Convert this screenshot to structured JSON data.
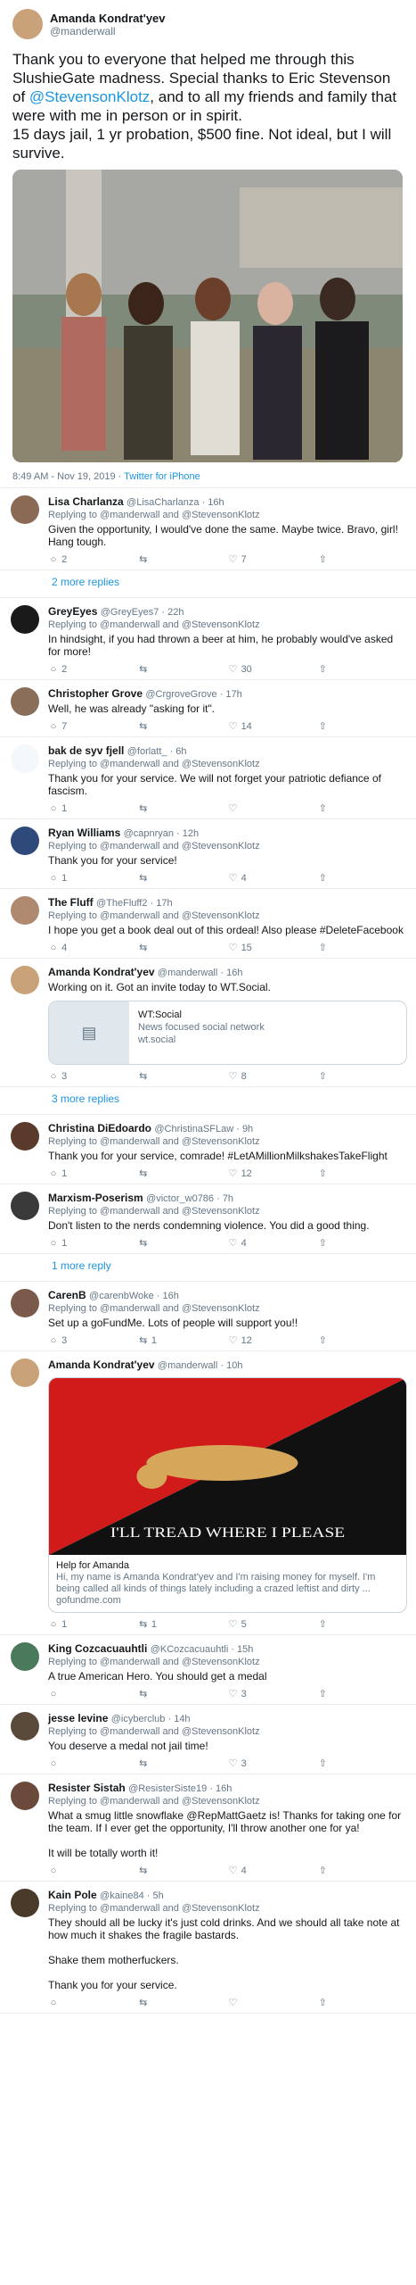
{
  "tweet": {
    "author": "Amanda Kondrat'yev",
    "handle": "@manderwall",
    "text_prefix": "Thank you to everyone that helped me through this SlushieGate madness. Special thanks to Eric Stevenson of ",
    "text_link": "@StevensonKlotz",
    "text_suffix": ", and to all my friends and family that were with me in person or in spirit.\n15 days jail, 1 yr probation, $500 fine. Not ideal, but I will survive.",
    "timestamp": "8:49 AM - Nov 19, 2019 · ",
    "client": "Twitter for iPhone"
  },
  "replies": [
    {
      "name": "Lisa Charlanza",
      "handle": "@LisaCharlanza · 16h",
      "replying": "Replying to @manderwall and @StevensonKlotz",
      "text": "Given the opportunity, I would've done the same. Maybe twice. Bravo, girl! Hang tough.",
      "reply_count": "2",
      "retweet_count": "",
      "like_count": "7"
    },
    {
      "name": "GreyEyes",
      "handle": "@GreyEyes7 · 22h",
      "replying": "Replying to @manderwall and @StevensonKlotz",
      "text": "In hindsight, if you had thrown a beer at him, he probably would've asked for more!",
      "reply_count": "2",
      "retweet_count": "",
      "like_count": "30"
    },
    {
      "name": "Christopher Grove",
      "handle": "@CrgroveGrove · 17h",
      "replying": "",
      "text": "Well, he was already \"asking for it\".",
      "reply_count": "7",
      "retweet_count": "",
      "like_count": "14"
    },
    {
      "name": "bak de syv fjell",
      "handle": "@forlatt_ · 6h",
      "replying": "Replying to @manderwall and @StevensonKlotz",
      "text": "Thank you for your service. We will not forget your patriotic defiance of fascism.",
      "reply_count": "1",
      "retweet_count": "",
      "like_count": ""
    },
    {
      "name": "Ryan Williams",
      "handle": "@capnryan · 12h",
      "replying": "Replying to @manderwall and @StevensonKlotz",
      "text": "Thank you for your service!",
      "reply_count": "1",
      "retweet_count": "",
      "like_count": "4"
    },
    {
      "name": "The Fluff",
      "handle": "@TheFluff2 · 17h",
      "replying": "Replying to @manderwall and @StevensonKlotz",
      "text": "I hope you get a book deal out of this ordeal! Also please #DeleteFacebook",
      "reply_count": "4",
      "retweet_count": "",
      "like_count": "15"
    },
    {
      "name": "Amanda Kondrat'yev",
      "handle": "@manderwall · 16h",
      "replying": "",
      "text": "Working on it. Got an invite today to WT.Social.",
      "reply_count": "3",
      "retweet_count": "",
      "like_count": "8"
    },
    {
      "name": "Christina DiEdoardo",
      "handle": "@ChristinaSFLaw · 9h",
      "replying": "Replying to @manderwall and @StevensonKlotz",
      "text": "Thank you for your service, comrade! #LetAMillionMilkshakesTakeFlight",
      "reply_count": "1",
      "retweet_count": "",
      "like_count": "12"
    },
    {
      "name": "Marxism-Poserism",
      "handle": "@victor_w0786 · 7h",
      "replying": "Replying to @manderwall and @StevensonKlotz",
      "text": "Don't listen to the nerds condemning violence. You did a good thing.",
      "reply_count": "1",
      "retweet_count": "",
      "like_count": "4"
    },
    {
      "name": "CarenB",
      "handle": "@carenbWoke · 16h",
      "replying": "Replying to @manderwall and @StevensonKlotz",
      "text": "Set up a goFundMe.  Lots of people will support you!!",
      "reply_count": "3",
      "retweet_count": "1",
      "like_count": "12"
    },
    {
      "name": "Amanda Kondrat'yev",
      "handle": "@manderwall · 10h",
      "replying": "",
      "text": "",
      "reply_count": "1",
      "retweet_count": "1",
      "like_count": "5"
    },
    {
      "name": "King Cozcacuauhtli",
      "handle": "@KCozcacuauhtli · 15h",
      "replying": "Replying to @manderwall and @StevensonKlotz",
      "text": "A true American Hero. You should get a medal",
      "reply_count": "",
      "retweet_count": "",
      "like_count": "3"
    },
    {
      "name": "jesse levine",
      "handle": "@icyberclub · 14h",
      "replying": "Replying to @manderwall and @StevensonKlotz",
      "text": "You deserve a medal not jail time!",
      "reply_count": "",
      "retweet_count": "",
      "like_count": "3"
    },
    {
      "name": "Resister Sistah",
      "handle": "@ResisterSiste19 · 16h",
      "replying": "Replying to @manderwall and @StevensonKlotz",
      "text": "What a smug little snowflake @RepMattGaetz is! Thanks for taking one for the team. If I ever get the opportunity, I'll throw another one for ya!\n\nIt will be totally worth it!",
      "reply_count": "",
      "retweet_count": "",
      "like_count": "4"
    },
    {
      "name": "Kain Pole",
      "handle": "@kaine84 · 5h",
      "replying": "Replying to @manderwall and @StevensonKlotz",
      "text": "They should all be lucky it's just cold drinks. And we should all take note at how much it shakes the fragile bastards.\n\nShake them motherfuckers.\n\nThank you for your service.",
      "reply_count": "",
      "retweet_count": "",
      "like_count": ""
    }
  ],
  "more_replies": {
    "first": "2 more replies",
    "second": "3 more replies",
    "third": "1 more reply"
  },
  "wt_card": {
    "title": "WT:Social",
    "desc": "News focused social network",
    "url": "wt.social"
  },
  "gofund_card": {
    "banner": "I'LL TREAD WHERE I PLEASE",
    "title": "Help for Amanda",
    "desc": "Hi, my name is Amanda Kondrat'yev and I'm raising money for myself. I'm being called all kinds of things lately including a crazed leftist and dirty ...",
    "url": "gofundme.com"
  },
  "icons": {
    "reply": "reply-icon",
    "retweet": "retweet-icon",
    "like": "heart-icon",
    "share": "share-icon"
  },
  "colors": {
    "link": "#1b95e0",
    "muted": "#657786",
    "border": "#e6ecf0"
  }
}
